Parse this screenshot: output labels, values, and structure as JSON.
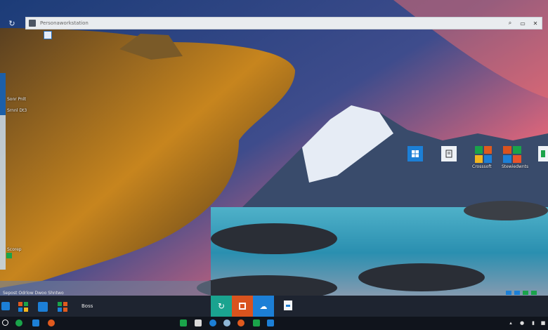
{
  "search": {
    "placeholder": "Personaworkstation"
  },
  "colors": {
    "accent": "#1c7fd6",
    "office_orange": "#d9531e",
    "teal": "#1aa38f",
    "green": "#1aa34a"
  },
  "side_panel": {
    "labels": [
      "Sonr Pnlt",
      "Srnnl Dt3",
      "Scorep"
    ]
  },
  "desktop_tiles": [
    {
      "icon": "windows-store-icon",
      "caption": ""
    },
    {
      "icon": "notepad-icon",
      "caption": ""
    },
    {
      "icon": "office-icon",
      "caption": "Crosssoft"
    },
    {
      "icon": "office-suite-icon",
      "caption": "Stewiedwnts"
    }
  ],
  "taskbar": {
    "status_text": "Sepost Odrlow Dwoo Shntwo",
    "window_label": "Boss",
    "apps": [
      "refresh-cloud-icon",
      "office-icon",
      "onedrive-icon",
      "document-icon"
    ]
  },
  "tray": {
    "icons": [
      "chevron-up-icon",
      "speaker-icon",
      "network-icon",
      "battery-icon"
    ]
  }
}
